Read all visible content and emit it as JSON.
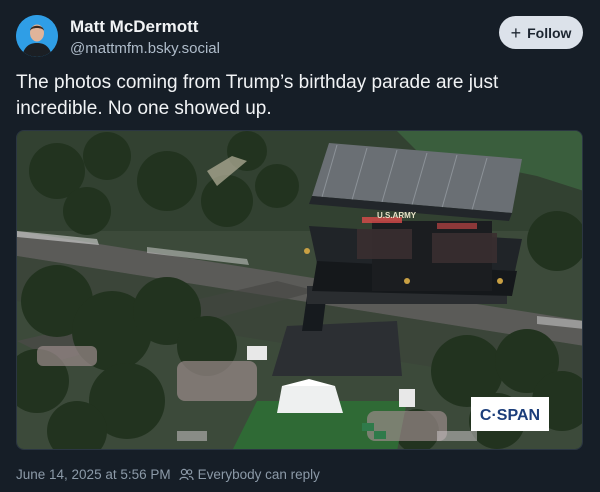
{
  "author": {
    "display_name": "Matt McDermott",
    "handle": "@mattmfm.bsky.social",
    "avatar_bg": "#2f9ee6"
  },
  "follow_button": {
    "icon": "plus-icon",
    "label": "Follow"
  },
  "post": {
    "text": "The photos coming from Trump’s birthday parade are just incredible. No one showed up.",
    "image": {
      "stage_sign": "U.S.ARMY",
      "watermark": "C·SPAN"
    }
  },
  "footer": {
    "timestamp": "June 14, 2025 at 5:56 PM",
    "reply_icon": "people-icon",
    "reply_setting": "Everybody can reply"
  },
  "colors": {
    "background": "#161e27",
    "text_primary": "#f1f3f5",
    "text_secondary": "#aebbc9",
    "follow_bg": "#dce2ea"
  }
}
